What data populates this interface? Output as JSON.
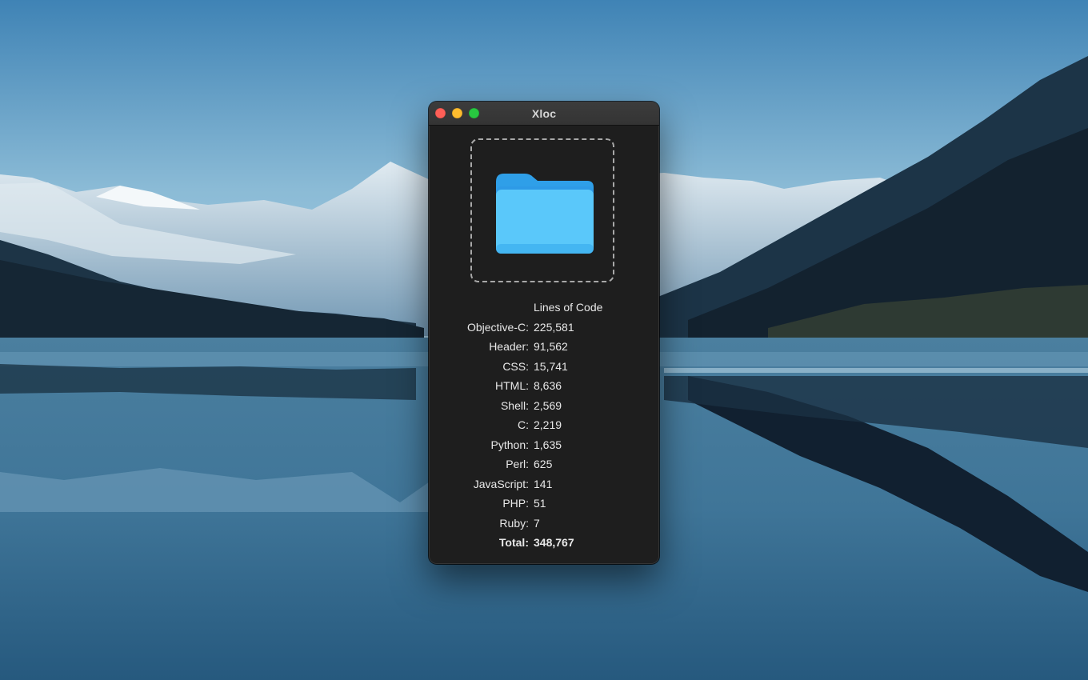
{
  "window": {
    "title": "Xloc"
  },
  "icons": {
    "folder": "folder-icon"
  },
  "colors": {
    "window_bg": "#1e1e1e",
    "close": "#ff5f57",
    "minimize": "#febc2e",
    "zoom": "#28c840",
    "folder": "#5ac8fa"
  },
  "stats": {
    "header": "Lines of Code",
    "rows": [
      {
        "label": "Objective-C:",
        "value": "225,581"
      },
      {
        "label": "Header:",
        "value": "91,562"
      },
      {
        "label": "CSS:",
        "value": "15,741"
      },
      {
        "label": "HTML:",
        "value": "8,636"
      },
      {
        "label": "Shell:",
        "value": "2,569"
      },
      {
        "label": "C:",
        "value": "2,219"
      },
      {
        "label": "Python:",
        "value": "1,635"
      },
      {
        "label": "Perl:",
        "value": "625"
      },
      {
        "label": "JavaScript:",
        "value": "141"
      },
      {
        "label": "PHP:",
        "value": "51"
      },
      {
        "label": "Ruby:",
        "value": "7"
      }
    ],
    "total": {
      "label": "Total:",
      "value": "348,767"
    }
  }
}
